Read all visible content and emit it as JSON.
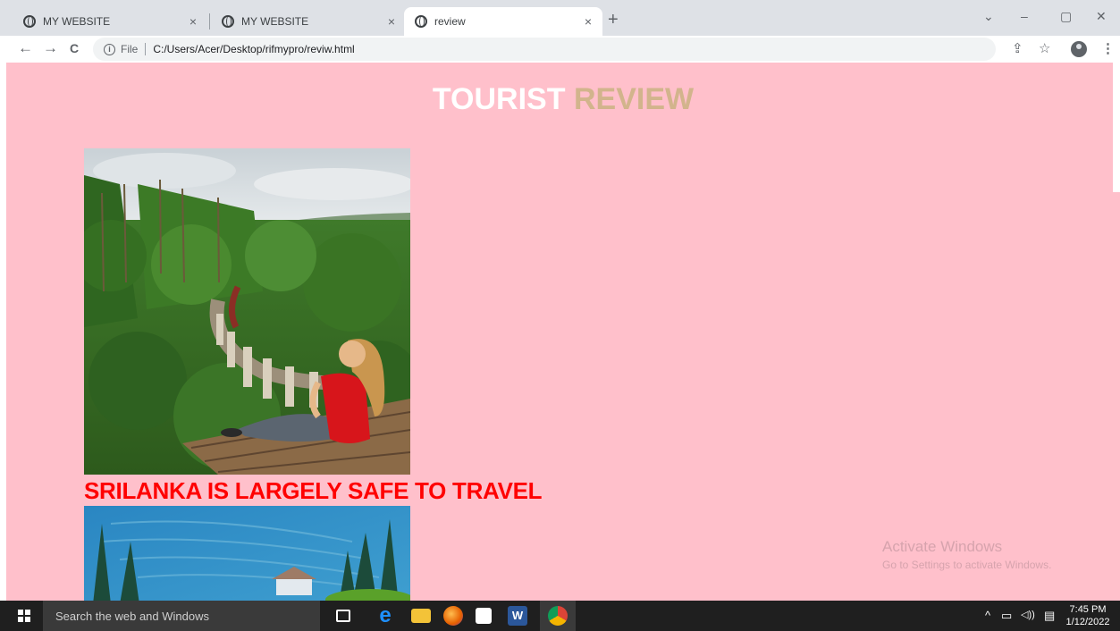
{
  "browser": {
    "tabs": [
      {
        "title": "MY WEBSITE",
        "active": false
      },
      {
        "title": "MY WEBSITE",
        "active": false
      },
      {
        "title": "review",
        "active": true
      }
    ],
    "close_glyph": "×",
    "new_tab_glyph": "+",
    "window_controls": [
      "⌄",
      "–",
      "▢",
      "✕"
    ],
    "nav": {
      "back": "←",
      "forward": "→",
      "reload": "C"
    },
    "address": {
      "scheme_label": "File",
      "url": "C:/Users/Acer/Desktop/rifmypro/reviw.html"
    },
    "toolbar_icons": [
      "share-icon",
      "star-icon",
      "profile-icon",
      "menu-icon"
    ],
    "toolbar_glyphs": {
      "share": "⇪",
      "star": "☆",
      "menu": "⋮"
    }
  },
  "page": {
    "background": "#ffc0cb",
    "title_word1": "TOURIST",
    "title_word2": "REVIEW",
    "title_color1": "#ffffff",
    "title_color2": "#d2b48c",
    "caption": "SRILANKA IS LARGELY SAFE TO TRAVEL",
    "caption_color": "#ff0000",
    "images": [
      "photo-nine-arch-bridge",
      "photo-tea-plantation"
    ]
  },
  "watermark": {
    "line1": "Activate Windows",
    "line2": "Go to Settings to activate Windows."
  },
  "taskbar": {
    "search_placeholder": "Search the web and Windows",
    "apps": [
      "task-view-icon",
      "edge-icon",
      "file-explorer-icon",
      "firefox-icon",
      "store-icon",
      "word-icon",
      "chrome-icon"
    ],
    "tray_glyphs": {
      "chevron": "^",
      "network": "▭",
      "volume": "◁))",
      "notification": "▤"
    },
    "time": "7:45 PM",
    "date": "1/12/2022"
  }
}
